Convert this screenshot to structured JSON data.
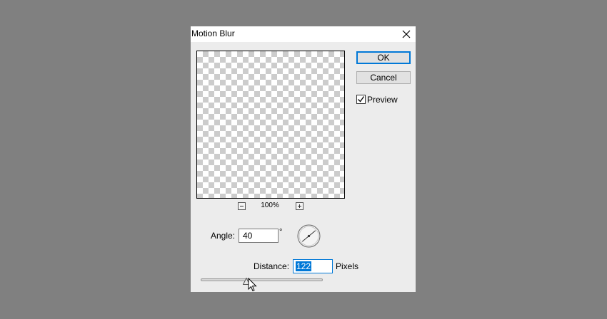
{
  "dialog": {
    "title": "Motion Blur",
    "close_icon": "close-icon"
  },
  "preview": {
    "zoom_level": "100%",
    "zoom_out_icon": "minus-icon",
    "zoom_in_icon": "plus-icon"
  },
  "buttons": {
    "ok_label": "OK",
    "cancel_label": "Cancel"
  },
  "preview_toggle": {
    "label": "Preview",
    "checked": true
  },
  "angle": {
    "label": "Angle:",
    "value": "40",
    "unit": "°"
  },
  "distance": {
    "label": "Distance:",
    "value": "122",
    "unit": "Pixels"
  },
  "colors": {
    "accent": "#0078d7",
    "dialog_bg": "#ececec",
    "backdrop": "#808080"
  }
}
